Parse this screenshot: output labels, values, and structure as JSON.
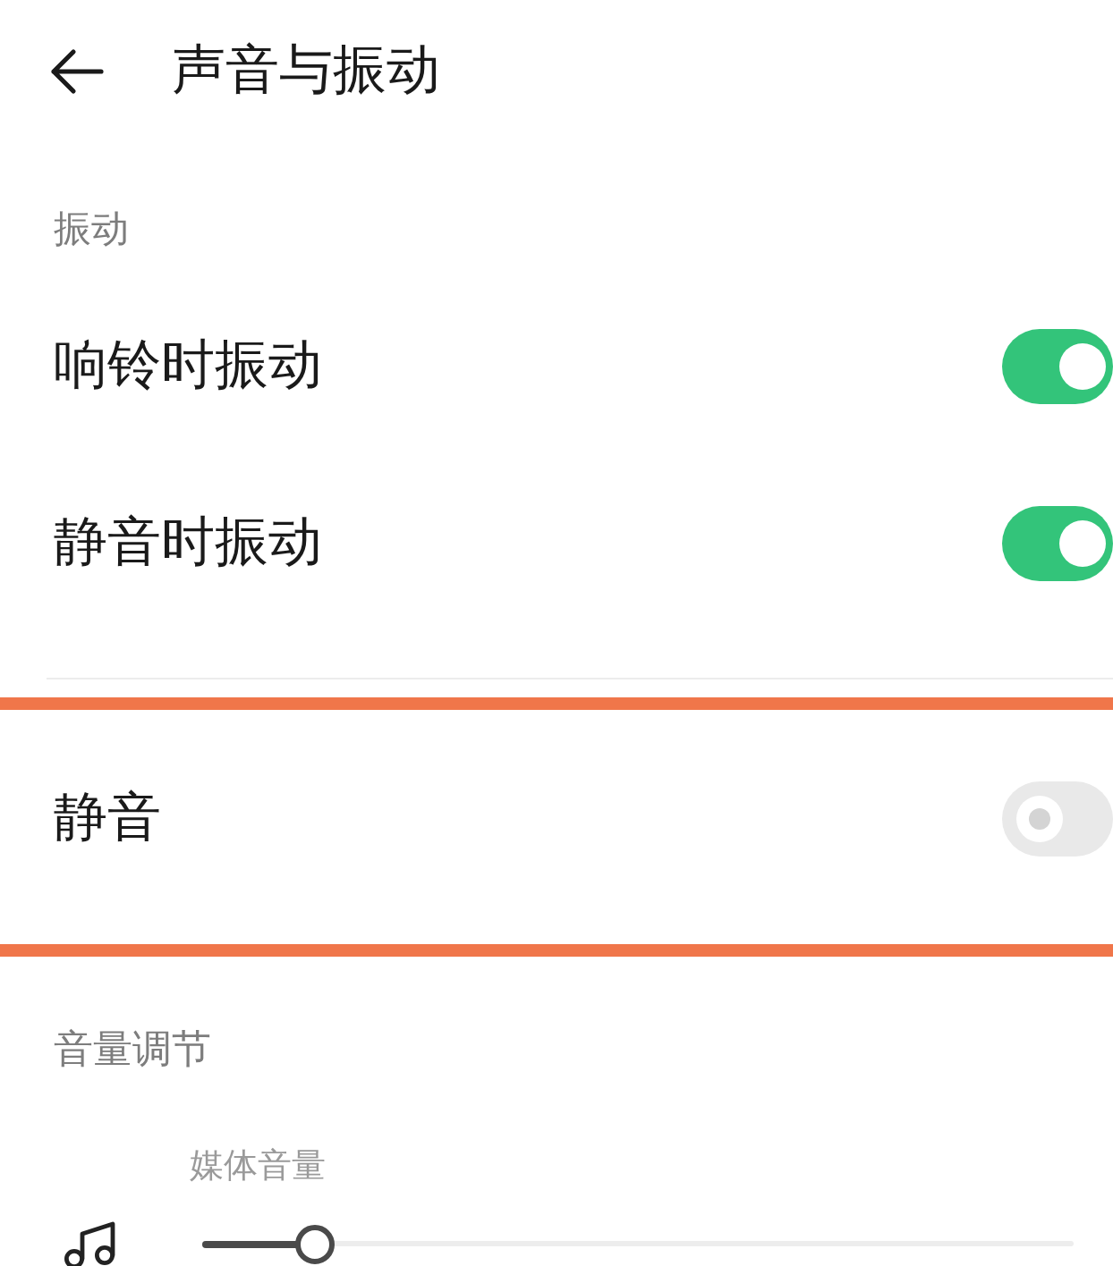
{
  "header": {
    "title": "声音与振动"
  },
  "vibration": {
    "heading": "振动",
    "rows": [
      {
        "label": "响铃时振动",
        "on": true
      },
      {
        "label": "静音时振动",
        "on": true
      }
    ]
  },
  "mute": {
    "label": "静音",
    "on": false,
    "highlighted": true
  },
  "volume": {
    "heading": "音量调节",
    "sliders": [
      {
        "label": "媒体音量",
        "level": 0.13
      }
    ]
  }
}
